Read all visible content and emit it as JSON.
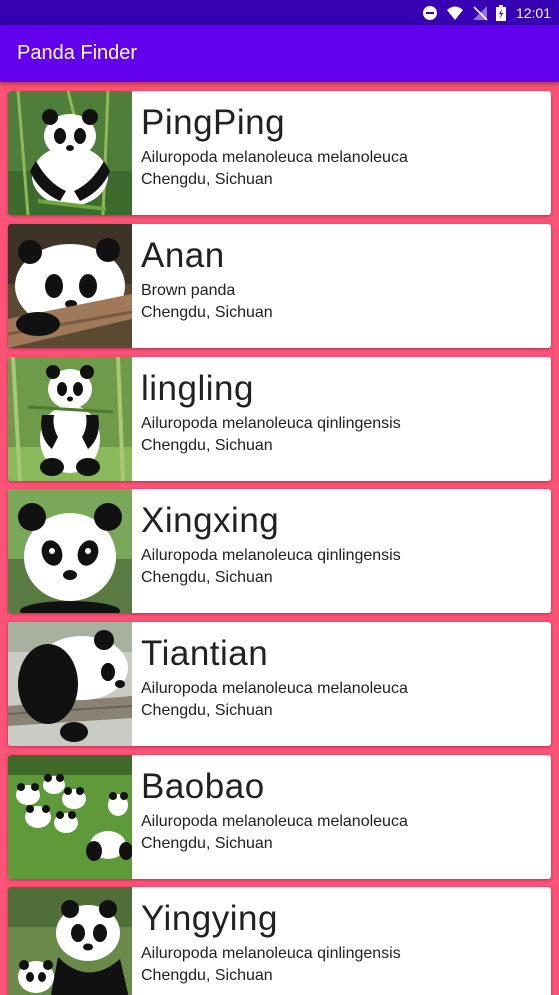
{
  "status_bar": {
    "time": "12:01",
    "icons": [
      "do-not-disturb-icon",
      "wifi-icon",
      "no-signal-icon",
      "battery-charging-icon"
    ]
  },
  "app_bar": {
    "title": "Panda Finder"
  },
  "colors": {
    "status_bar": "#3700b3",
    "app_bar": "#6200ee",
    "list_background": "#ff5277",
    "card": "#ffffff",
    "text": "#212121"
  },
  "pandas": [
    {
      "name": "PingPing",
      "species": "Ailuropoda melanoleuca melanoleuca",
      "location": "Chengdu, Sichuan",
      "photo": "panda-eating-bamboo-photo"
    },
    {
      "name": "Anan",
      "species": "Brown panda",
      "location": "Chengdu, Sichuan",
      "photo": "panda-on-log-photo"
    },
    {
      "name": "lingling",
      "species": "Ailuropoda melanoleuca qinlingensis",
      "location": "Chengdu, Sichuan",
      "photo": "panda-sitting-photo"
    },
    {
      "name": "Xingxing",
      "species": "Ailuropoda melanoleuca qinlingensis",
      "location": "Chengdu, Sichuan",
      "photo": "panda-face-photo"
    },
    {
      "name": "Tiantian",
      "species": "Ailuropoda melanoleuca melanoleuca",
      "location": "Chengdu, Sichuan",
      "photo": "panda-sleeping-on-branch-photo"
    },
    {
      "name": "Baobao",
      "species": "Ailuropoda melanoleuca melanoleuca",
      "location": "Chengdu, Sichuan",
      "photo": "panda-group-on-grass-photo"
    },
    {
      "name": "Yingying",
      "species": "Ailuropoda melanoleuca qinlingensis",
      "location": "Chengdu, Sichuan",
      "photo": "panda-mother-and-cub-photo"
    }
  ]
}
